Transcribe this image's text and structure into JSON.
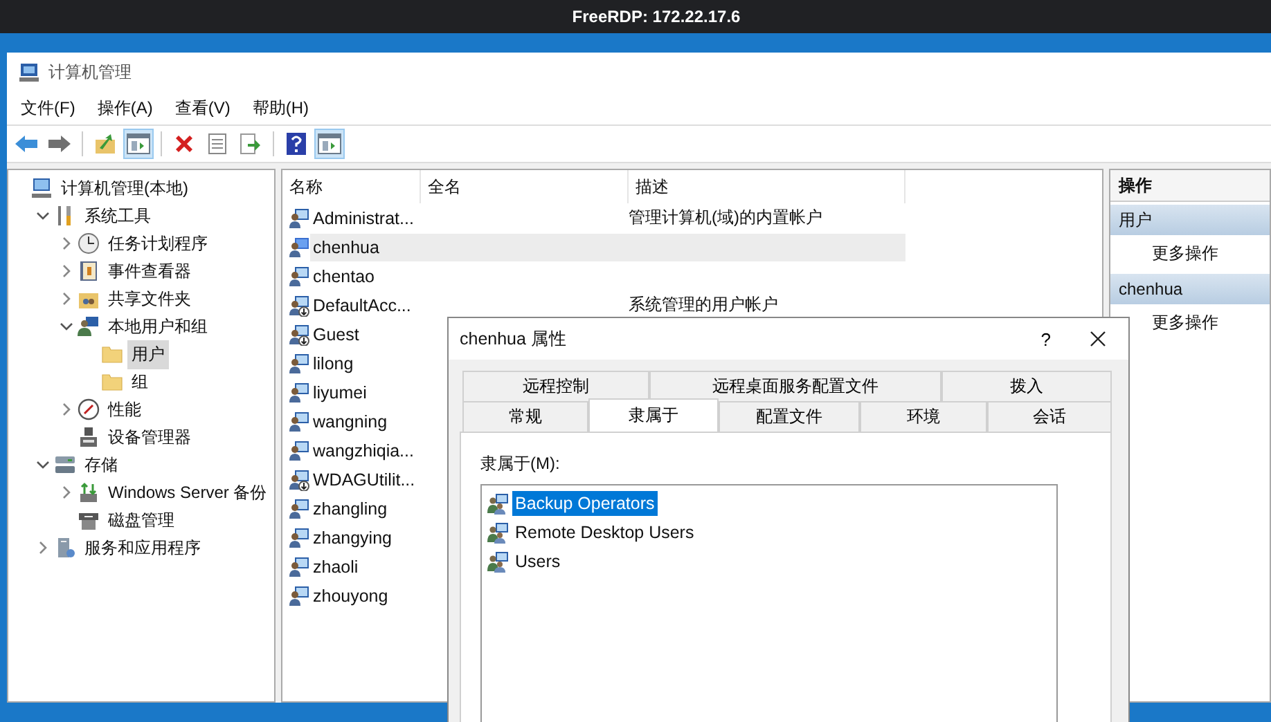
{
  "remote_bar": {
    "title": "FreeRDP: 172.22.17.6"
  },
  "window": {
    "title": "计算机管理"
  },
  "menu": [
    "文件(F)",
    "操作(A)",
    "查看(V)",
    "帮助(H)"
  ],
  "toolbar": [
    {
      "kind": "button",
      "pressed": false
    },
    {
      "kind": "button",
      "pressed": false
    },
    {
      "kind": "separator"
    },
    {
      "kind": "button",
      "pressed": false
    },
    {
      "kind": "button",
      "pressed": true
    },
    {
      "kind": "separator"
    },
    {
      "kind": "button",
      "pressed": false
    },
    {
      "kind": "button",
      "pressed": false
    },
    {
      "kind": "button",
      "pressed": false
    },
    {
      "kind": "separator"
    },
    {
      "kind": "button",
      "pressed": false
    },
    {
      "kind": "button",
      "pressed": true
    }
  ],
  "tree": [
    {
      "label": "计算机管理(本地)",
      "selected": false,
      "children": [
        {
          "label": "系统工具",
          "expanded": true,
          "selected": false,
          "children": [
            {
              "label": "任务计划程序",
              "expanded": false,
              "selected": false
            },
            {
              "label": "事件查看器",
              "expanded": false,
              "selected": false
            },
            {
              "label": "共享文件夹",
              "expanded": false,
              "selected": false
            },
            {
              "label": "本地用户和组",
              "expanded": true,
              "selected": false,
              "children": [
                {
                  "label": "用户",
                  "selected": true
                },
                {
                  "label": "组",
                  "selected": false
                }
              ]
            },
            {
              "label": "性能",
              "expanded": false,
              "selected": false
            },
            {
              "label": "设备管理器",
              "selected": false
            }
          ]
        },
        {
          "label": "存储",
          "expanded": true,
          "selected": false,
          "children": [
            {
              "label": "Windows Server 备份",
              "expanded": false,
              "selected": false
            },
            {
              "label": "磁盘管理",
              "selected": false
            }
          ]
        },
        {
          "label": "服务和应用程序",
          "expanded": false,
          "selected": false
        }
      ]
    }
  ],
  "list": {
    "columns": [
      "名称",
      "全名",
      "描述"
    ],
    "rows": [
      {
        "name": "Administrat...",
        "description": "管理计算机(域)的内置帐户",
        "disabled": false,
        "selected": false
      },
      {
        "name": "chenhua",
        "disabled": false,
        "selected": true
      },
      {
        "name": "chentao",
        "disabled": false,
        "selected": false
      },
      {
        "name": "DefaultAcc...",
        "description": "系统管理的用户帐户",
        "disabled": true,
        "selected": false
      },
      {
        "name": "Guest",
        "disabled": true,
        "selected": false
      },
      {
        "name": "lilong",
        "disabled": false,
        "selected": false
      },
      {
        "name": "liyumei",
        "disabled": false,
        "selected": false
      },
      {
        "name": "wangning",
        "disabled": false,
        "selected": false
      },
      {
        "name": "wangzhiqia...",
        "disabled": false,
        "selected": false
      },
      {
        "name": "WDAGUtilit...",
        "disabled": true,
        "selected": false
      },
      {
        "name": "zhangling",
        "disabled": false,
        "selected": false
      },
      {
        "name": "zhangying",
        "disabled": false,
        "selected": false
      },
      {
        "name": "zhaoli",
        "disabled": false,
        "selected": false
      },
      {
        "name": "zhouyong",
        "disabled": false,
        "selected": false
      }
    ]
  },
  "actions": {
    "title": "操作",
    "sections": [
      {
        "title": "用户",
        "items": [
          "更多操作"
        ]
      },
      {
        "title": "chenhua",
        "items": [
          "更多操作"
        ]
      }
    ]
  },
  "dialog": {
    "title": "chenhua 属性",
    "help": "?",
    "tab_rows": [
      [
        {
          "label": "远程控制",
          "selected": false
        },
        {
          "label": "远程桌面服务配置文件",
          "selected": false
        },
        {
          "label": "拨入",
          "selected": false
        }
      ],
      [
        {
          "label": "常规",
          "selected": false
        },
        {
          "label": "隶属于",
          "selected": true
        },
        {
          "label": "配置文件",
          "selected": false
        },
        {
          "label": "环境",
          "selected": false
        },
        {
          "label": "会话",
          "selected": false
        }
      ]
    ],
    "member_label": "隶属于(M):",
    "groups": [
      {
        "name": "Backup Operators",
        "selected": true
      },
      {
        "name": "Remote Desktop Users",
        "selected": false
      },
      {
        "name": "Users",
        "selected": false
      }
    ]
  }
}
